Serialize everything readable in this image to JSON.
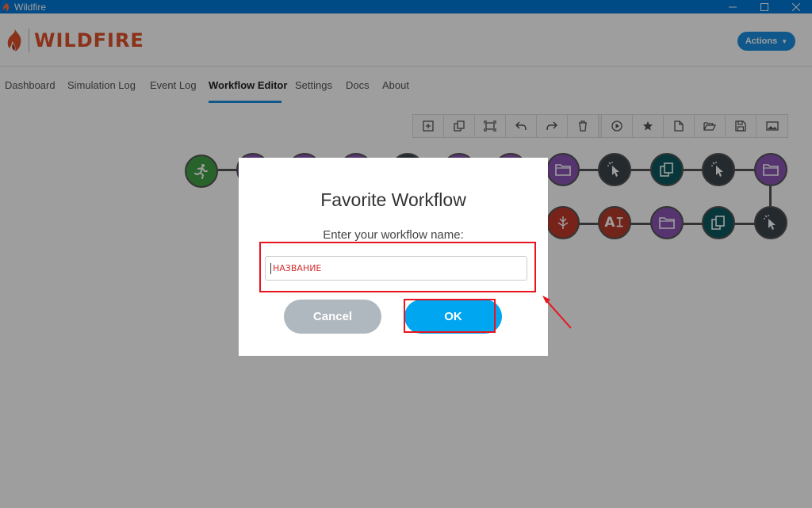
{
  "window": {
    "title": "Wildfire"
  },
  "header": {
    "logo_text": "WILDFIRE",
    "actions_label": "Actions"
  },
  "nav": {
    "tabs": [
      {
        "label": "Dashboard"
      },
      {
        "label": "Simulation Log"
      },
      {
        "label": "Event Log"
      },
      {
        "label": "Workflow Editor",
        "active": true
      },
      {
        "label": "Settings"
      },
      {
        "label": "Docs"
      },
      {
        "label": "About"
      }
    ]
  },
  "toolbar": {
    "icons": [
      "add-node-icon",
      "duplicate-icon",
      "fit-screen-icon",
      "undo-icon",
      "redo-icon",
      "delete-icon",
      "play-icon",
      "favorite-icon",
      "new-file-icon",
      "open-folder-icon",
      "save-icon",
      "image-icon"
    ]
  },
  "workflow": {
    "nodes_row1": [
      "green-runner",
      "purple",
      "purple",
      "purple",
      "dark",
      "purple",
      "purple",
      "purple-folder",
      "dark-click",
      "teal-copy",
      "dark-click",
      "purple-folder"
    ],
    "nodes_row2": [
      "red-flame",
      "red-ai",
      "purple-folder",
      "teal-copy",
      "dark-click"
    ],
    "ai_node_text": "A𝙸"
  },
  "modal": {
    "title": "Favorite Workflow",
    "label": "Enter your workflow name:",
    "input_value": "НАЗВАНИЕ",
    "cancel_label": "Cancel",
    "ok_label": "OK"
  },
  "colors": {
    "titlebar": "#0078d7",
    "accent": "#1a8fe3",
    "ok_button": "#00a6f0",
    "cancel_button": "#b0b8bf",
    "logo": "#e0522a",
    "annotation": "#e8141e"
  }
}
